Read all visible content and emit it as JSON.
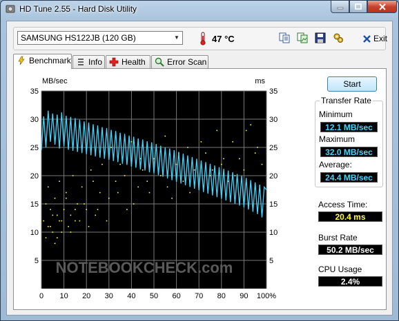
{
  "window": {
    "title": "HD Tune 2.55 - Hard Disk Utility"
  },
  "toolbar": {
    "drive": "SAMSUNG HS122JB (120 GB)",
    "temperature": "47 °C",
    "exit_label": "Exit",
    "icons": [
      "copy-text-icon",
      "copy-screenshot-icon",
      "save-icon",
      "options-icon",
      "exit-icon"
    ]
  },
  "tabs": [
    {
      "label": "Benchmark",
      "icon": "benchmark-icon",
      "active": true
    },
    {
      "label": "Info",
      "icon": "info-icon",
      "active": false
    },
    {
      "label": "Health",
      "icon": "health-icon",
      "active": false
    },
    {
      "label": "Error Scan",
      "icon": "error-scan-icon",
      "active": false
    }
  ],
  "benchmark": {
    "start_label": "Start",
    "transfer_rate_title": "Transfer Rate",
    "minimum_label": "Minimum",
    "minimum_value": "12.1 MB/sec",
    "maximum_label": "Maximum",
    "maximum_value": "32.0 MB/sec",
    "average_label": "Average:",
    "average_value": "24.4 MB/sec",
    "access_time_label": "Access Time:",
    "access_time_value": "20.4 ms",
    "burst_rate_label": "Burst Rate",
    "burst_rate_value": "50.2 MB/sec",
    "cpu_usage_label": "CPU Usage",
    "cpu_usage_value": "2.4%",
    "colors": {
      "transfer": "#3fd7ff",
      "access": "#ffff3a",
      "background": "#000000",
      "grid": "#808080"
    }
  },
  "chart_data": {
    "type": "line",
    "xlabel": "%",
    "ylabel": "MB/sec",
    "y2label": "ms",
    "xlim": [
      0,
      100
    ],
    "ylim": [
      0,
      35
    ],
    "y2lim": [
      0,
      35
    ],
    "grid": true,
    "x_ticks": [
      0,
      10,
      20,
      30,
      40,
      50,
      60,
      70,
      80,
      90,
      100
    ],
    "x_tick_labels": [
      "0",
      "10",
      "20",
      "30",
      "40",
      "50",
      "60",
      "70",
      "80",
      "90",
      "100%"
    ],
    "y_ticks": [
      5,
      10,
      15,
      20,
      25,
      30,
      35
    ],
    "watermark": "NOTEBOOKCHECK.com",
    "series": [
      {
        "kind": "transfer_rate_line",
        "x": [
          0,
          1,
          2,
          3,
          4,
          5,
          6,
          7,
          8,
          9,
          10,
          11,
          12,
          13,
          14,
          15,
          16,
          17,
          18,
          19,
          20,
          21,
          22,
          23,
          24,
          25,
          26,
          27,
          28,
          29,
          30,
          31,
          32,
          33,
          34,
          35,
          36,
          37,
          38,
          39,
          40,
          41,
          42,
          43,
          44,
          45,
          46,
          47,
          48,
          49,
          50,
          51,
          52,
          53,
          54,
          55,
          56,
          57,
          58,
          59,
          60,
          61,
          62,
          63,
          64,
          65,
          66,
          67,
          68,
          69,
          70,
          71,
          72,
          73,
          74,
          75,
          76,
          77,
          78,
          79,
          80,
          81,
          82,
          83,
          84,
          85,
          86,
          87,
          88,
          89,
          90,
          91,
          92,
          93,
          94,
          95,
          96,
          97,
          98,
          99,
          100
        ],
        "y": [
          24.5,
          30.5,
          25,
          31.5,
          26,
          31,
          25.5,
          30.8,
          24.8,
          31.2,
          25.2,
          30.6,
          24.6,
          30.4,
          24.4,
          30.2,
          24.2,
          29.9,
          24,
          29.6,
          23.8,
          29.4,
          23.6,
          29.1,
          23.4,
          28.9,
          23.2,
          28.6,
          23,
          28.4,
          22.8,
          28.1,
          22.6,
          27.9,
          22.4,
          27.6,
          22.1,
          27.4,
          21.9,
          27.1,
          21.6,
          26.9,
          21.4,
          26.6,
          21.1,
          26.4,
          20.9,
          26.1,
          20.6,
          25.9,
          20.4,
          25.6,
          20.1,
          25.3,
          19.8,
          25,
          19.5,
          24.8,
          19.2,
          24.5,
          18.9,
          24.2,
          18.6,
          23.9,
          18.3,
          23.6,
          18,
          23.3,
          17.7,
          23,
          17.4,
          22.7,
          17.1,
          22.4,
          16.8,
          22.1,
          16.5,
          21.8,
          16.2,
          21.5,
          15.9,
          21.2,
          15.6,
          20.9,
          15.3,
          20.6,
          15,
          20.3,
          14.7,
          20,
          14.4,
          19.6,
          14,
          19.2,
          13.6,
          18.8,
          13.2,
          18.4,
          12.6,
          18,
          17.5
        ]
      },
      {
        "kind": "access_time_scatter",
        "x": [
          1,
          2,
          2,
          3,
          4,
          4,
          5,
          6,
          6,
          7,
          8,
          8,
          9,
          10,
          11,
          12,
          13,
          14,
          15,
          16,
          18,
          20,
          22,
          24,
          26,
          28,
          30,
          33,
          35,
          38,
          40,
          43,
          45,
          48,
          50,
          53,
          55,
          58,
          60,
          63,
          65,
          68,
          70,
          73,
          75,
          78,
          80,
          83,
          85,
          88,
          90,
          93,
          95,
          98,
          3,
          5,
          7,
          9,
          11,
          13,
          15,
          17,
          19,
          21,
          23,
          25,
          27,
          29,
          31,
          34,
          37,
          41,
          44,
          47,
          52,
          56,
          61,
          66,
          71,
          76,
          81,
          86,
          91,
          96
        ],
        "y": [
          12,
          15,
          9,
          18,
          11,
          14,
          10,
          16,
          8,
          13,
          12,
          19,
          10,
          14,
          17,
          11,
          13,
          20,
          12,
          15,
          18,
          14,
          21,
          13,
          17,
          24,
          16,
          19,
          22,
          14,
          26,
          18,
          21,
          17,
          23,
          20,
          27,
          16,
          22,
          19,
          25,
          21,
          18,
          24,
          20,
          28,
          22,
          19,
          26,
          23,
          21,
          29,
          24,
          22,
          11,
          13,
          9,
          12,
          16,
          10,
          14,
          12,
          15,
          11,
          19,
          14,
          22,
          12,
          25,
          17,
          20,
          15,
          23,
          19,
          21,
          18,
          24,
          17,
          26,
          21,
          23,
          20,
          28,
          25
        ]
      }
    ]
  }
}
